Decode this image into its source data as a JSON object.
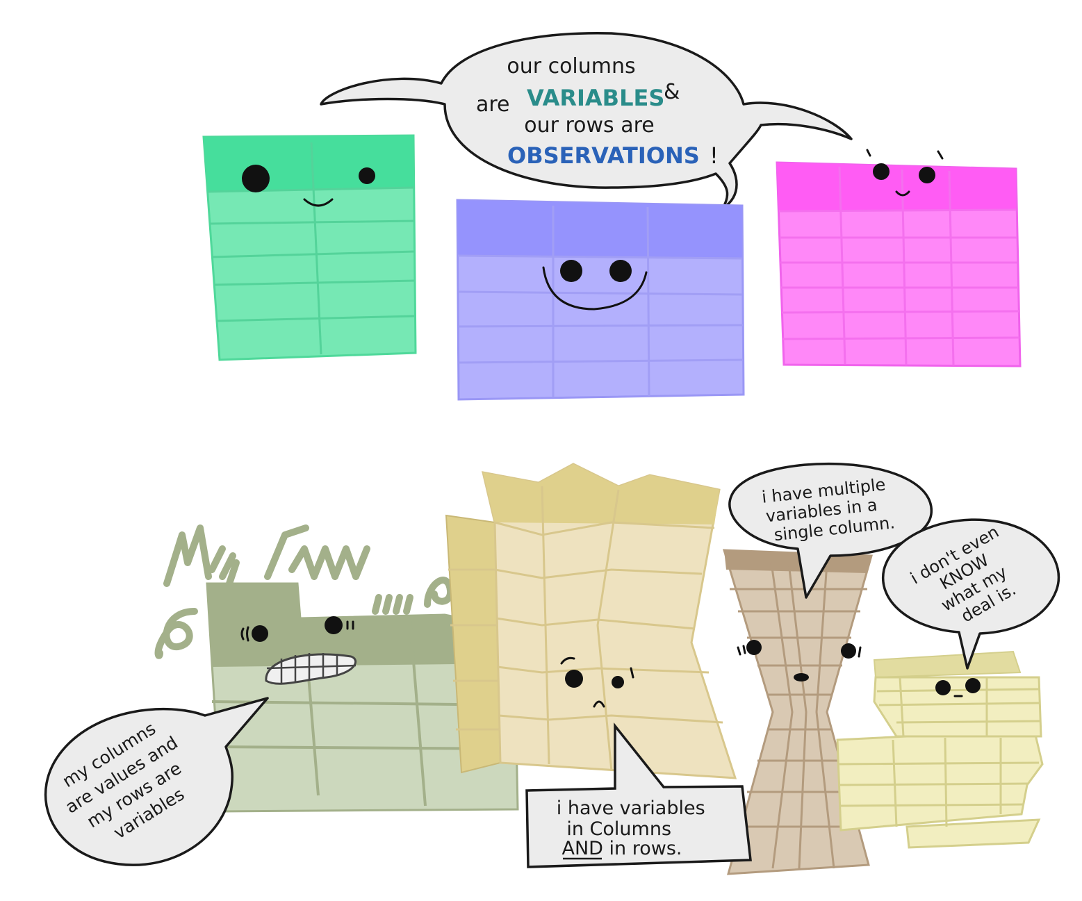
{
  "top_bubble": {
    "line1": "our columns",
    "line2_prefix": "are",
    "line2_highlight": "VARIABLES",
    "line2_suffix": "&",
    "line3": "our rows are",
    "line4_highlight": "OBSERVATIONS",
    "line4_suffix": "!"
  },
  "bottom_left_bubble": [
    "my columns",
    "are values and",
    "my rows are",
    "variables"
  ],
  "bottom_center_box": [
    "i have variables",
    "in Columns",
    "AND in rows."
  ],
  "bottom_right_bubble_1": [
    "i have multiple",
    "variables in a",
    "single column."
  ],
  "bottom_right_bubble_2": [
    "i don't even",
    "KNOW",
    "what my",
    "deal is."
  ],
  "colors": {
    "teal_text": "#2a8c8a",
    "blue_text": "#2a62b8",
    "green_table": "#76e8b4",
    "green_header": "#46de9c",
    "purple_table": "#b3b0fd",
    "purple_header": "#9593fd",
    "pink_table": "#ff88f8",
    "pink_header": "#ff5cf4",
    "olive_table": "#ccd8bd",
    "olive_header": "#a3b08a",
    "tan_table": "#eee2bf",
    "tan_header": "#dfd08c",
    "brown_table": "#d9c9b3",
    "brown_header": "#b39b7e",
    "yellow_table": "#f2eec0"
  },
  "characters": [
    {
      "name": "tidy-green-table",
      "mood": "happy"
    },
    {
      "name": "tidy-purple-table",
      "mood": "happy"
    },
    {
      "name": "tidy-pink-table",
      "mood": "happy"
    },
    {
      "name": "messy-olive-table",
      "mood": "frustrated"
    },
    {
      "name": "messy-tan-table",
      "mood": "sad"
    },
    {
      "name": "messy-brown-table",
      "mood": "worried"
    },
    {
      "name": "messy-yellow-table",
      "mood": "confused"
    }
  ]
}
